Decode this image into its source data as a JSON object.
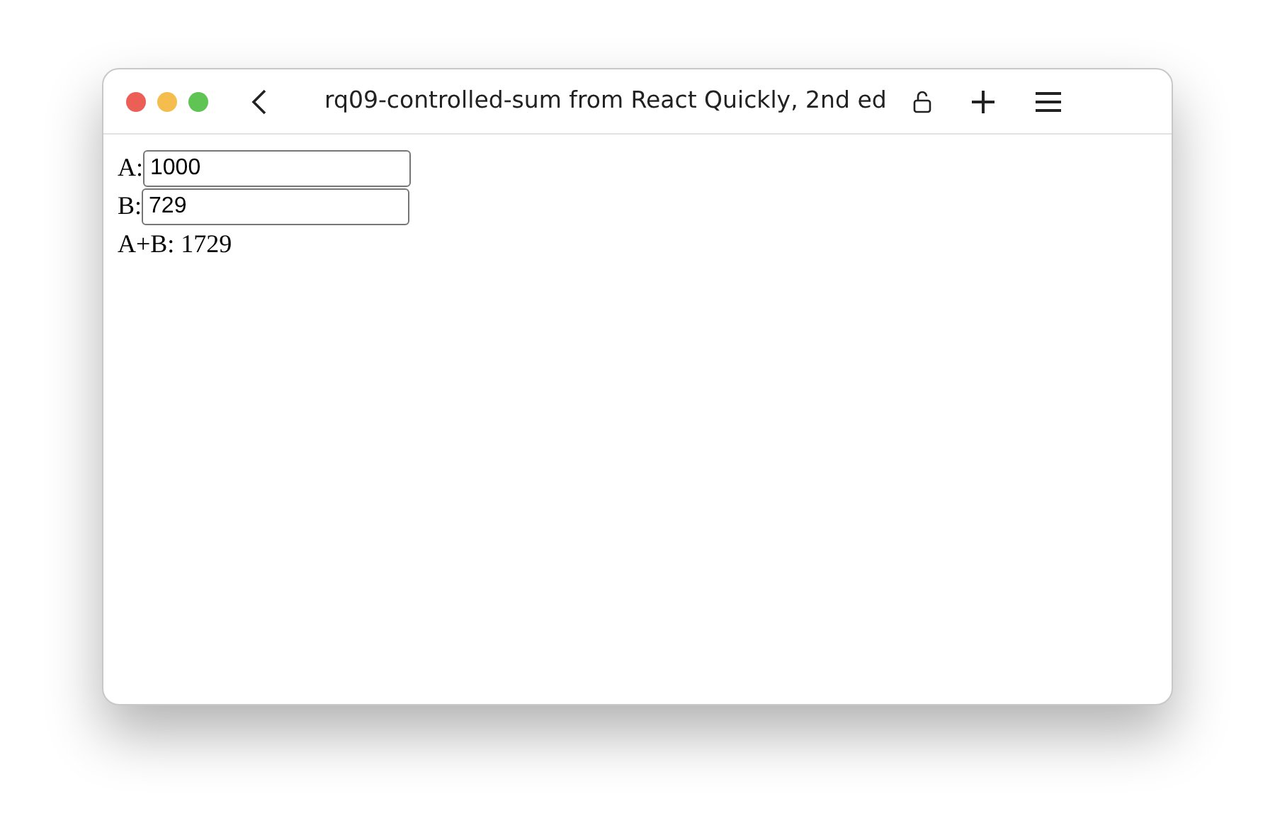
{
  "window": {
    "title": "rq09-controlled-sum from React Quickly, 2nd ed"
  },
  "fields": [
    {
      "label": "A:",
      "value": "1000"
    },
    {
      "label": "B:",
      "value": "729"
    }
  ],
  "result": "A+B: 1729"
}
